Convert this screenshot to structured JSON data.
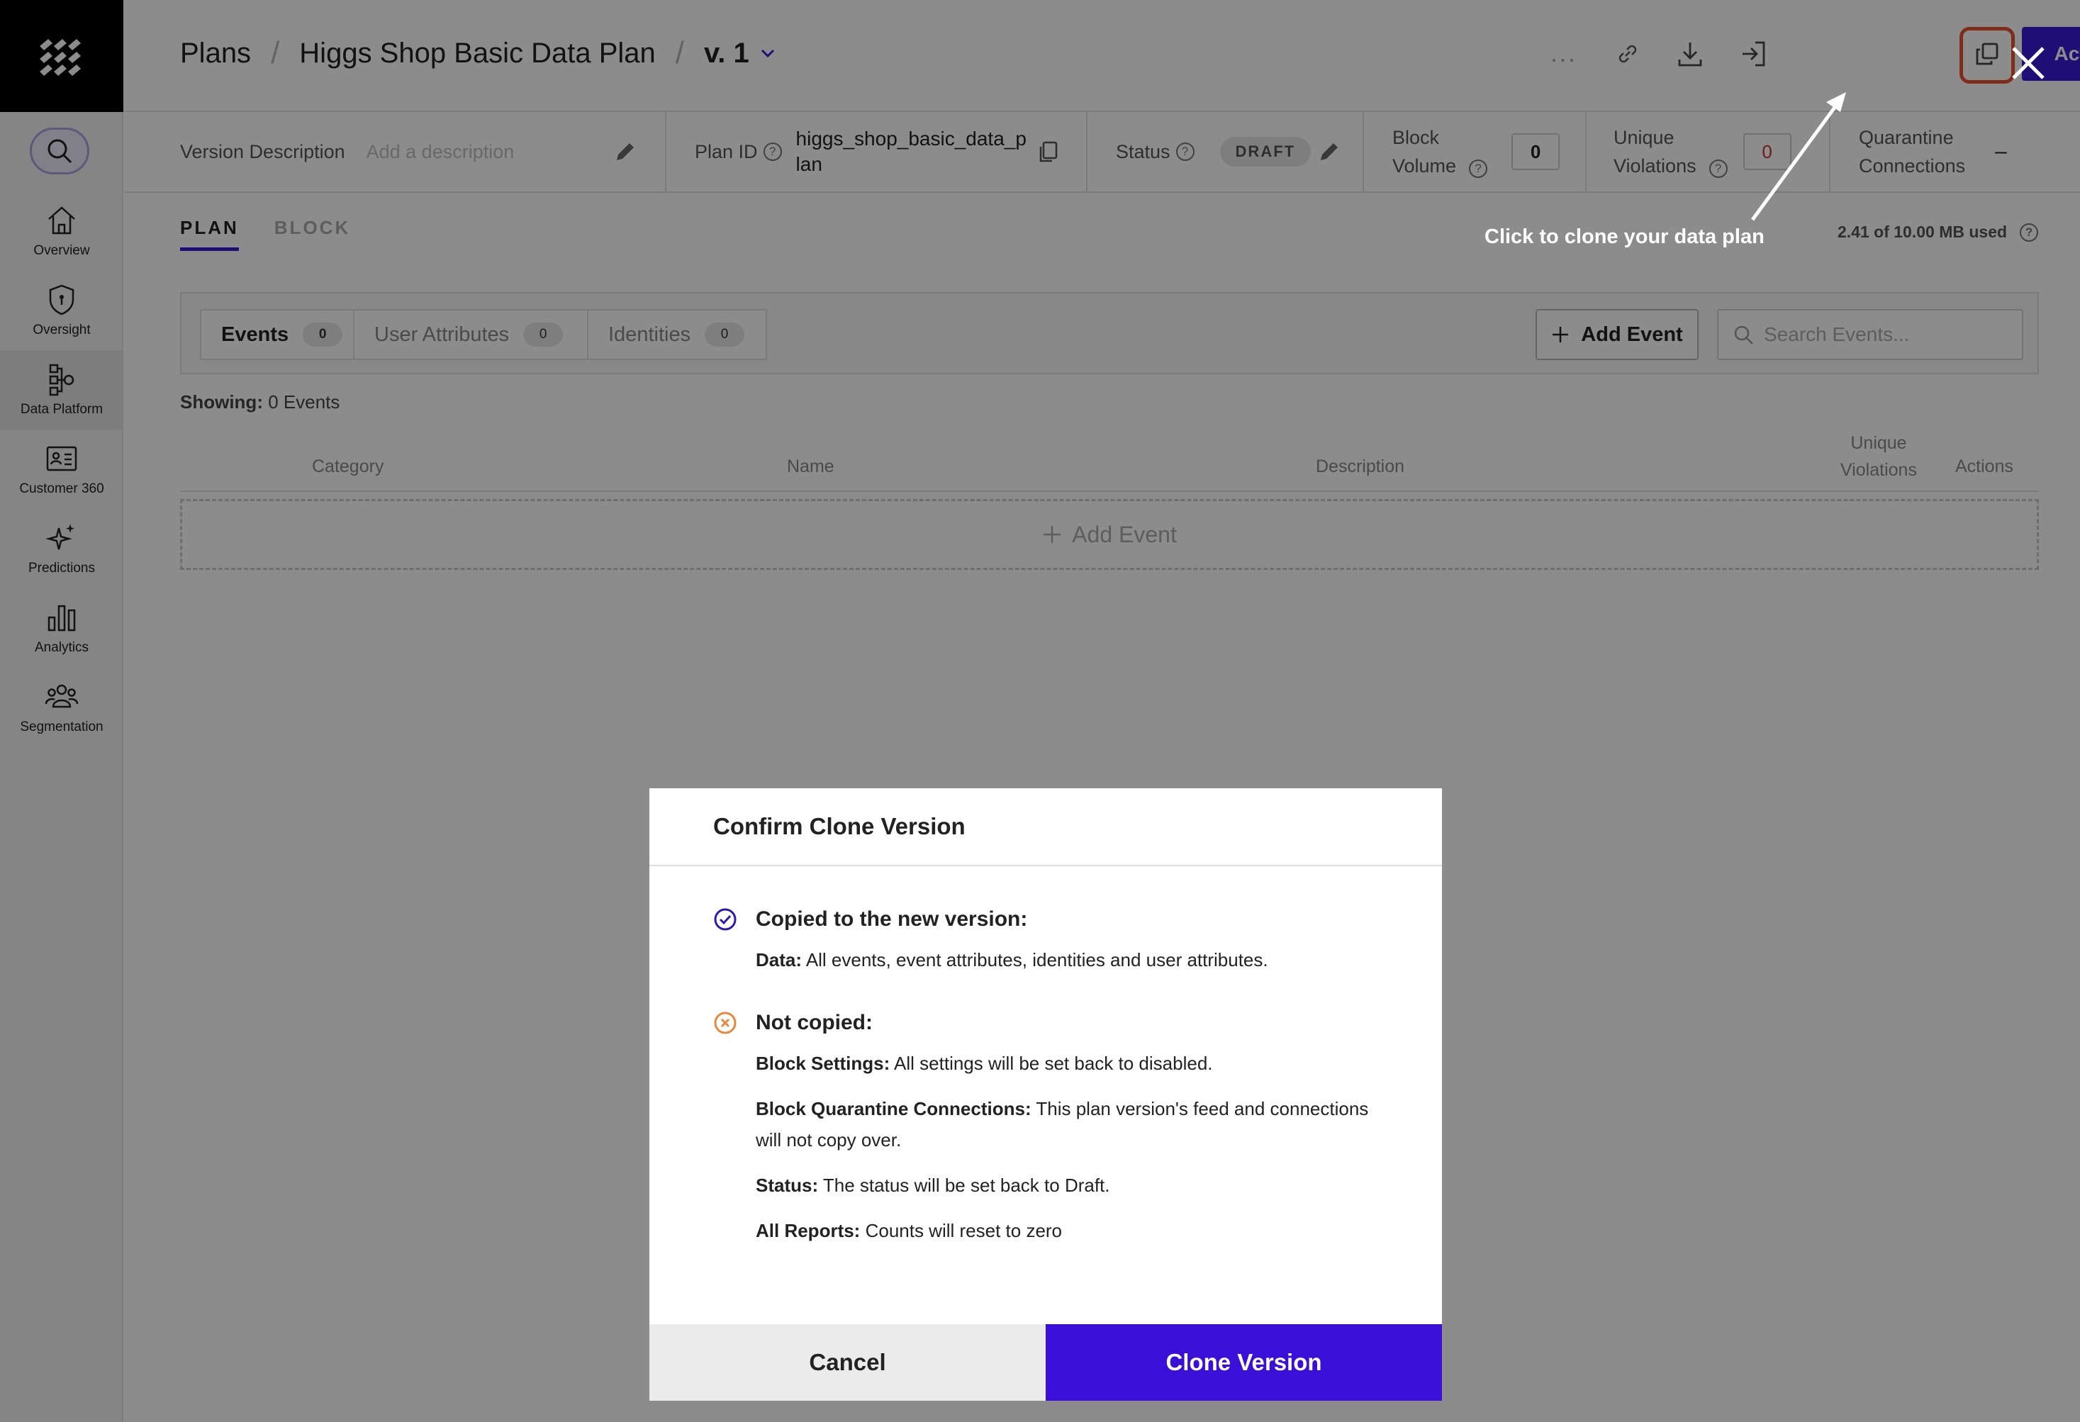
{
  "sidebar": {
    "items": [
      {
        "label": "Overview",
        "icon": "home-icon"
      },
      {
        "label": "Oversight",
        "icon": "shield-icon"
      },
      {
        "label": "Data Platform",
        "icon": "data-platform-icon"
      },
      {
        "label": "Customer 360",
        "icon": "id-card-icon"
      },
      {
        "label": "Predictions",
        "icon": "sparkle-icon"
      },
      {
        "label": "Analytics",
        "icon": "bar-chart-icon"
      },
      {
        "label": "Segmentation",
        "icon": "people-icon"
      }
    ]
  },
  "header": {
    "crumb_plans": "Plans",
    "crumb_plan": "Higgs Shop Basic Data Plan",
    "version": "v. 1",
    "more": "...",
    "activate_label": "Activate"
  },
  "infobar": {
    "version_description_label": "Version Description",
    "version_description_placeholder": "Add a description",
    "plan_id_label": "Plan ID",
    "plan_id_value_1": "higgs_shop_basic_data_p",
    "plan_id_value_2": "lan",
    "status_label": "Status",
    "status_value": "DRAFT",
    "block_volume_label_1": "Block",
    "block_volume_label_2": "Volume",
    "block_volume_value": "0",
    "unique_violations_label_1": "Unique",
    "unique_violations_label_2": "Violations",
    "unique_violations_value": "0",
    "quarantine_label_1": "Quarantine",
    "quarantine_label_2": "Connections",
    "quarantine_value": "–"
  },
  "main": {
    "tabs": [
      {
        "label": "PLAN"
      },
      {
        "label": "BLOCK"
      }
    ],
    "usage": "2.41 of 10.00 MB used",
    "segments": [
      {
        "label": "Events",
        "count": "0"
      },
      {
        "label": "User Attributes",
        "count": "0"
      },
      {
        "label": "Identities",
        "count": "0"
      }
    ],
    "add_event_label": "Add Event",
    "search_placeholder": "Search Events...",
    "showing_label": "Showing:",
    "showing_value": "0 Events",
    "columns": {
      "category": "Category",
      "name": "Name",
      "description": "Description",
      "unique_violations_1": "Unique",
      "unique_violations_2": "Violations",
      "actions": "Actions"
    },
    "add_event_row_label": "Add Event"
  },
  "hint": "Click to clone your data plan",
  "dialog": {
    "title": "Confirm Clone Version",
    "copied_heading": "Copied to the new version:",
    "copied_lines": [
      {
        "label": "Data:",
        "text": "All events, event attributes, identities and user attributes."
      }
    ],
    "not_copied_heading": "Not copied:",
    "not_copied_lines": [
      {
        "label": "Block Settings:",
        "text": "All settings will be set back to disabled."
      },
      {
        "label": "Block Quarantine Connections:",
        "text": "This plan version's feed and connections will not copy over."
      },
      {
        "label": "Status:",
        "text": "The status will be set back to Draft."
      },
      {
        "label": "All Reports:",
        "text": "Counts will reset to zero"
      }
    ],
    "cancel_label": "Cancel",
    "clone_label": "Clone Version"
  },
  "colors": {
    "brand": "#3a1bd6",
    "clone_button": "#3a0fd8",
    "highlight": "#e8532d",
    "check": "#2a1bb0",
    "x_icon": "#e8883a"
  }
}
